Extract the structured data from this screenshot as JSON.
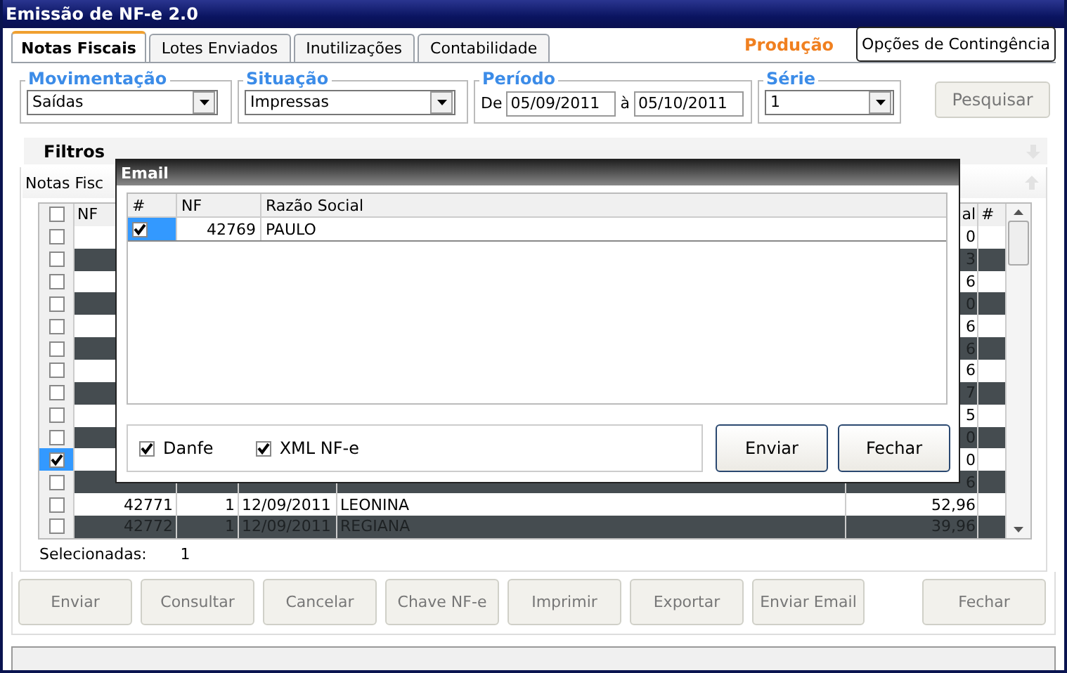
{
  "window": {
    "title": "Emissão de NF-e 2.0"
  },
  "tabs": [
    {
      "label": "Notas Fiscais",
      "selected": true
    },
    {
      "label": "Lotes Enviados",
      "selected": false
    },
    {
      "label": "Inutilizações",
      "selected": false
    },
    {
      "label": "Contabilidade",
      "selected": false
    }
  ],
  "environment": "Produção",
  "contingency_button": "Opções de Contingência",
  "filters": {
    "movimentacao": {
      "label": "Movimentação",
      "value": "Saídas"
    },
    "situacao": {
      "label": "Situação",
      "value": "Impressas"
    },
    "periodo": {
      "label": "Período",
      "from_label": "De",
      "from": "05/09/2011",
      "to_label": "à",
      "to": "05/10/2011"
    },
    "serie": {
      "label": "Série",
      "value": "1"
    },
    "search_button": "Pesquisar"
  },
  "filters_panel": {
    "title": "Filtros"
  },
  "notes_panel": {
    "title": "Notas Fisc"
  },
  "grid": {
    "header_checked": false,
    "columns": [
      "NF",
      "al",
      "#"
    ],
    "rows": [
      {
        "checked": false,
        "total": "0"
      },
      {
        "checked": false,
        "total": "3"
      },
      {
        "checked": false,
        "total": "6"
      },
      {
        "checked": false,
        "total": "0"
      },
      {
        "checked": false,
        "total": "6"
      },
      {
        "checked": false,
        "total": "6"
      },
      {
        "checked": false,
        "total": "6"
      },
      {
        "checked": false,
        "total": "7"
      },
      {
        "checked": false,
        "total": "5"
      },
      {
        "checked": false,
        "total": "0"
      },
      {
        "checked": true,
        "total": "0"
      },
      {
        "checked": false,
        "total": "6"
      },
      {
        "checked": false,
        "nf": "42771",
        "serie": "1",
        "date": "12/09/2011",
        "name": "LEONINA",
        "total": "52,96"
      },
      {
        "checked": false,
        "nf": "42772",
        "serie": "1",
        "date": "12/09/2011",
        "name": "REGIANA",
        "total": "39,96"
      }
    ]
  },
  "selected_count": {
    "label": "Selecionadas:",
    "value": "1"
  },
  "actions": [
    "Enviar",
    "Consultar",
    "Cancelar",
    "Chave NF-e",
    "Imprimir",
    "Exportar",
    "Enviar Email"
  ],
  "close_button": "Fechar",
  "dialog": {
    "title": "Email",
    "columns": [
      "#",
      "NF",
      "Razão Social"
    ],
    "rows": [
      {
        "checked": true,
        "nf": "42769",
        "name": "PAULO"
      }
    ],
    "options": [
      {
        "label": "Danfe",
        "checked": true
      },
      {
        "label": "XML NF-e",
        "checked": true
      }
    ],
    "buttons": [
      "Enviar",
      "Fechar"
    ]
  }
}
